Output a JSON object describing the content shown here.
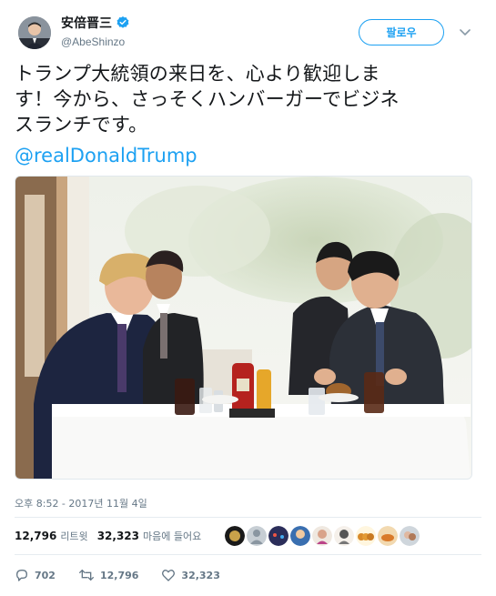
{
  "user": {
    "display_name": "安倍晋三",
    "handle": "@AbeShinzo",
    "verified": true
  },
  "follow_button_label": "팔로우",
  "tweet": {
    "line1": "トランプ大統領の来日を、心より歓迎しま",
    "line2": "す！今から、さっそくハンバーガーでビジネ",
    "line3": "スランチです。",
    "mention": "@realDonaldTrump"
  },
  "timestamp": "오후 8:52 - 2017년 11월 4일",
  "stats": {
    "retweets_count": "12,796",
    "retweets_label": "리트윗",
    "likes_count": "32,323",
    "likes_label": "마음에 들어요"
  },
  "actions": {
    "reply_count": "702",
    "retweet_count": "12,796",
    "like_count": "32,323"
  },
  "colors": {
    "accent": "#1da1f2",
    "text": "#14171a",
    "secondary": "#657786"
  },
  "icons": [
    "verified-badge-icon",
    "chevron-down-icon",
    "reply-icon",
    "retweet-icon",
    "heart-icon"
  ]
}
